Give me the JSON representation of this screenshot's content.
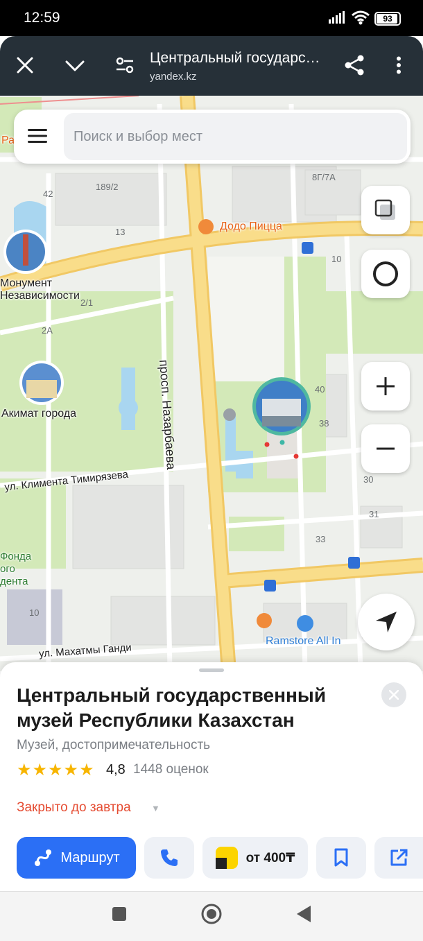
{
  "status_bar": {
    "time": "12:59",
    "battery": "93",
    "battery_level": 0.93
  },
  "browser": {
    "title": "Центральный государс…",
    "url": "yandex.kz",
    "icons": [
      "close-icon",
      "chevron-down-icon",
      "tune-icon",
      "share-icon",
      "more-vert-icon"
    ]
  },
  "search": {
    "placeholder": "Поиск и выбор мест"
  },
  "map": {
    "streets": {
      "nazarbayev": "просп. Назарбаева",
      "timiryazev": "ул. Климента Тимирязева",
      "gandhi": "ул. Махатмы Ганди"
    },
    "places": {
      "monument_line1": "Монумент",
      "monument_line2": "Независимости",
      "akimat": "Акимат города",
      "dodo": "Додо Пицца",
      "ramstore": "Ramstore All In",
      "fund_line1": "Фонда",
      "fund_line2": "ого",
      "fund_line3": "дента",
      "edge_letter": "Ра"
    },
    "house_numbers": {
      "h1892": "189/2",
      "h42": "42",
      "h13": "13",
      "h21": "2/1",
      "h2a": "2А",
      "h8g7a": "8Г/7А",
      "h10a": "10",
      "h40": "40",
      "h38": "38",
      "h30": "30",
      "h31": "31",
      "h33": "33",
      "h10b": "10"
    },
    "controls": [
      "layers-icon",
      "alice-icon",
      "zoom-in-icon",
      "zoom-out-icon",
      "navigation-arrow-icon"
    ]
  },
  "place": {
    "title": "Центральный государственный музей Республики Казахстан",
    "category": "Музей, достопримечательность",
    "stars": "★★★★★",
    "rating": "4,8",
    "rating_count": "1448 оценок",
    "hours": "Закрыто до завтра",
    "actions": {
      "route": "Маршрут",
      "taxi": "от 400₸"
    }
  },
  "colors": {
    "toolbar": "#263038",
    "primary": "#2b6ff5",
    "closed": "#e54c32",
    "star": "#f7b500",
    "road": "#f6d77a",
    "park": "#cfe7b0"
  }
}
